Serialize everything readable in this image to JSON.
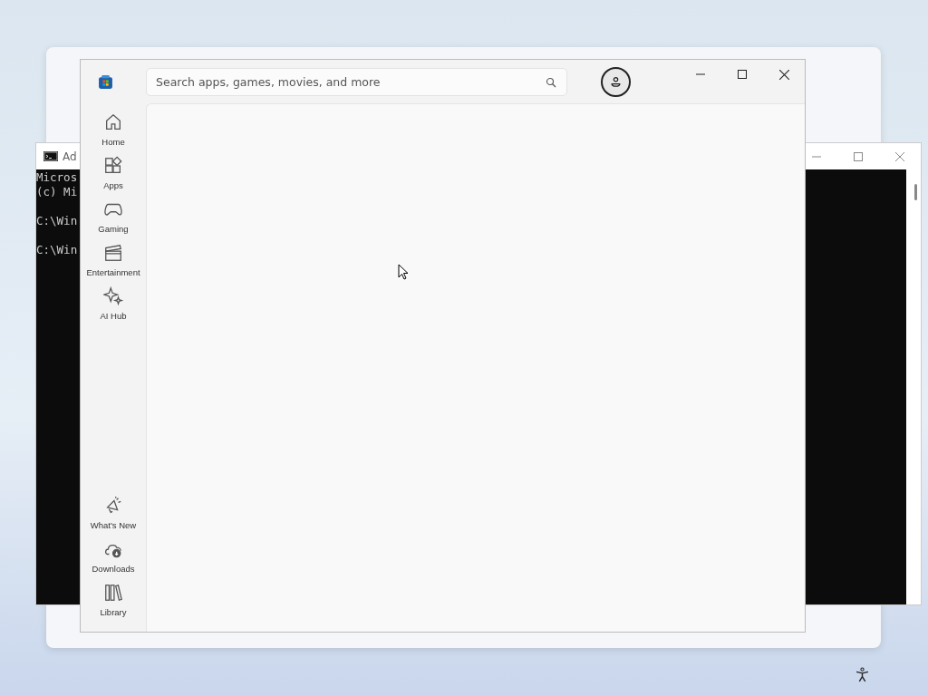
{
  "console_window": {
    "title": "Ad",
    "blocks": [
      [
        "Micros",
        "(c) Mi"
      ],
      [
        "C:\\Win"
      ],
      [
        "C:\\Win"
      ]
    ]
  },
  "store_window": {
    "search": {
      "placeholder": "Search apps, games, movies, and more"
    },
    "nav_top": [
      {
        "kind": "home",
        "label": "Home",
        "selected": false
      },
      {
        "kind": "apps",
        "label": "Apps",
        "selected": false
      },
      {
        "kind": "gaming",
        "label": "Gaming",
        "selected": false
      },
      {
        "kind": "entertainment",
        "label": "Entertainment",
        "selected": false
      },
      {
        "kind": "ai",
        "label": "AI Hub",
        "selected": false
      }
    ],
    "nav_bottom": [
      {
        "kind": "whatsnew",
        "label": "What's New",
        "selected": false
      },
      {
        "kind": "downloads",
        "label": "Downloads",
        "selected": false
      },
      {
        "kind": "library",
        "label": "Library",
        "selected": false
      }
    ]
  }
}
